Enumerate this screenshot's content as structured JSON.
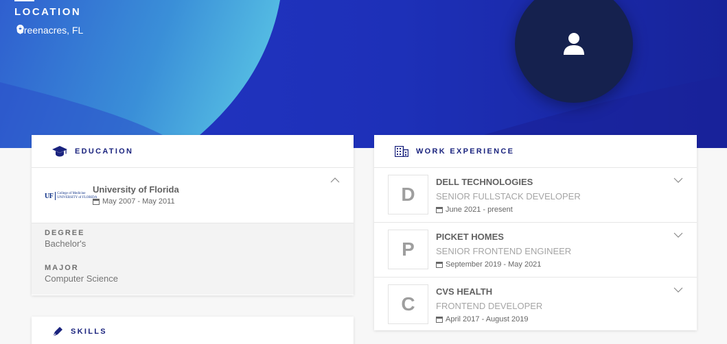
{
  "location": {
    "title": "LOCATION",
    "city": "Greenacres, FL",
    "icon": "map-pin-icon"
  },
  "avatar": {
    "icon": "user-icon"
  },
  "education": {
    "title": "EDUCATION",
    "icon": "graduation-cap-icon",
    "school": {
      "name": "University of Florida",
      "dates": "May 2007 - May 2011",
      "logo_mark": "UF",
      "logo_line1": "College of Medicine",
      "logo_line2": "UNIVERSITY of FLORIDA"
    },
    "degree_label": "DEGREE",
    "degree_value": "Bachelor's",
    "major_label": "MAJOR",
    "major_value": "Computer Science"
  },
  "skills": {
    "title": "SKILLS",
    "icon": "pen-icon"
  },
  "work": {
    "title": "WORK EXPERIENCE",
    "icon": "building-icon",
    "jobs": [
      {
        "initial": "D",
        "company": "DELL TECHNOLOGIES",
        "role": "SENIOR FULLSTACK DEVELOPER",
        "dates": "June 2021 - present"
      },
      {
        "initial": "P",
        "company": "PICKET HOMES",
        "role": "SENIOR FRONTEND ENGINEER",
        "dates": "September 2019 - May 2021"
      },
      {
        "initial": "C",
        "company": "CVS HEALTH",
        "role": "FRONTEND DEVELOPER",
        "dates": "April 2017 - August 2019"
      }
    ]
  },
  "colors": {
    "hero_blue": "#1d30b8",
    "hero_light": "#4fb6e0",
    "navy": "#1a237e",
    "avatar_bg": "#15214e"
  }
}
